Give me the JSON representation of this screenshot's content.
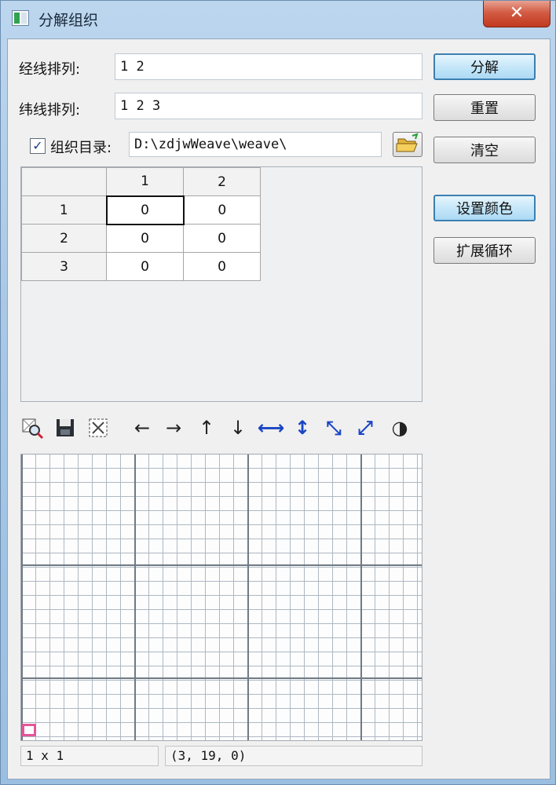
{
  "window": {
    "title": "分解组织",
    "close_glyph": "✕"
  },
  "form": {
    "warp_label": "经线排列:",
    "warp_value": "1 2",
    "weft_label": "纬线排列:",
    "weft_value": "1 2 3",
    "dir_checked": true,
    "dir_label": "组织目录:",
    "dir_value": "D:\\zdjwWeave\\weave\\"
  },
  "buttons": {
    "decompose": "分解",
    "reset": "重置",
    "clear": "清空",
    "set_color": "设置颜色",
    "expand_loop": "扩展循环"
  },
  "table": {
    "col_headers": [
      "1",
      "2"
    ],
    "rows": [
      {
        "label": "1",
        "cells": [
          "0",
          "0"
        ]
      },
      {
        "label": "2",
        "cells": [
          "0",
          "0"
        ]
      },
      {
        "label": "3",
        "cells": [
          "0",
          "0"
        ]
      }
    ]
  },
  "toolbar": {
    "icons": [
      "zoom-search-icon",
      "save-icon",
      "fit-icon",
      "arrow-left-icon",
      "arrow-right-icon",
      "arrow-up-icon",
      "arrow-down-icon",
      "flip-horizontal-icon",
      "flip-vertical-icon",
      "diagonal-down-icon",
      "diagonal-up-icon",
      "invert-icon"
    ],
    "glyphs": {
      "left": "←",
      "right": "→",
      "up": "↑",
      "down": "↓",
      "hflip": "⟷",
      "vflip": "↕",
      "diag1": "⤡",
      "diag2": "⤢",
      "invert": "◑"
    }
  },
  "status": {
    "size": "1 x 1",
    "coords": "(3, 19, 0)"
  },
  "colors": {
    "accent": "#3c7fb1",
    "cursor": "#e5559a",
    "close": "#c1391f"
  }
}
